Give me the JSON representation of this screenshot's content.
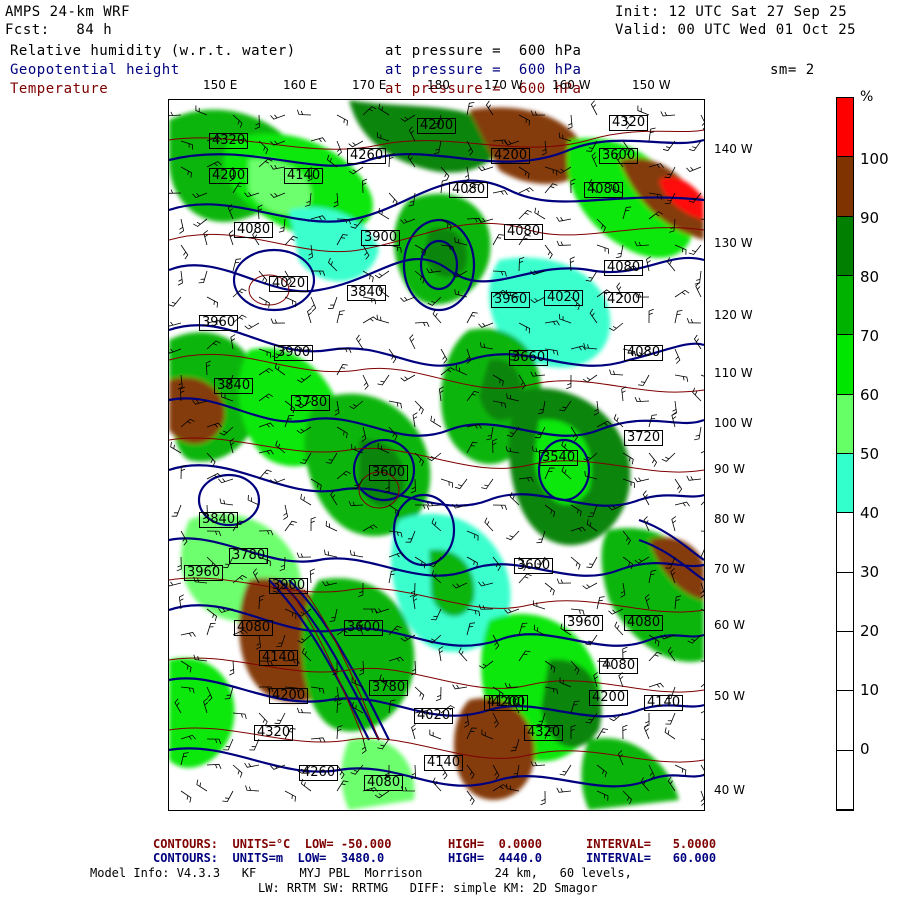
{
  "header": {
    "model": "AMPS 24-km WRF",
    "fcst": "Fcst:   84 h",
    "init": "Init: 12 UTC Sat 27 Sep 25",
    "valid": "Valid: 00 UTC Wed 01 Oct 25",
    "fields": [
      {
        "name": "Relative humidity (w.r.t. water)",
        "level": "at pressure =  600 hPa",
        "color": "#000000"
      },
      {
        "name": "Geopotential height",
        "level": "at pressure =  600 hPa",
        "color": "#00007f"
      },
      {
        "name": "Temperature",
        "level": "at pressure =  600 hPa",
        "color": "#7f0000"
      }
    ],
    "smoothing": "sm= 2"
  },
  "map": {
    "lon_labels": [
      "150 E",
      "160 E",
      "170 E",
      "180",
      "170 W",
      "160 W",
      "150 W"
    ],
    "lat_labels": [
      "140 W",
      "130 W",
      "120 W",
      "110 W",
      "100 W",
      "90 W",
      "80 W",
      "70 W",
      "60 W",
      "50 W",
      "40 W"
    ],
    "height_labels": [
      "4320",
      "4260",
      "4200",
      "4140",
      "4080",
      "4020",
      "3960",
      "3900",
      "3840",
      "3780",
      "3720",
      "3660",
      "3600",
      "3540",
      "4320",
      "4200",
      "4080",
      "3960",
      "3900",
      "3840",
      "3780",
      "3660",
      "3600",
      "4200",
      "4140",
      "4080",
      "4020",
      "4260",
      "4140",
      "4080"
    ],
    "colors": {
      "height": "#00007f",
      "temp": "#7f0000",
      "barb": "#000000"
    }
  },
  "colorbar": {
    "unit": "%",
    "labels": [
      "100",
      "90",
      "80",
      "70",
      "60",
      "50",
      "40",
      "30",
      "20",
      "10",
      "0"
    ],
    "colors": [
      "#ff0000",
      "#7f3300",
      "#007f00",
      "#00b200",
      "#00e600",
      "#66ff66",
      "#33ffcc",
      "#ffffff",
      "#ffffff",
      "#ffffff",
      "#ffffff",
      "#ffffff"
    ]
  },
  "footer": {
    "temp_contours": {
      "label": "CONTOURS:  UNITS=°C  LOW= -50.000",
      "high": "HIGH=  0.0000",
      "interval": "INTERVAL=   5.0000"
    },
    "height_contours": {
      "label": "CONTOURS:  UNITS=m  LOW=  3480.0",
      "high": "HIGH=  4440.0",
      "interval": "INTERVAL=   60.000"
    },
    "model_info": "Model Info: V4.3.3   KF      MYJ PBL  Morrison          24 km,   60 levels,",
    "model_info2": "LW: RRTM SW: RRTMG   DIFF: simple KM: 2D Smagor"
  }
}
